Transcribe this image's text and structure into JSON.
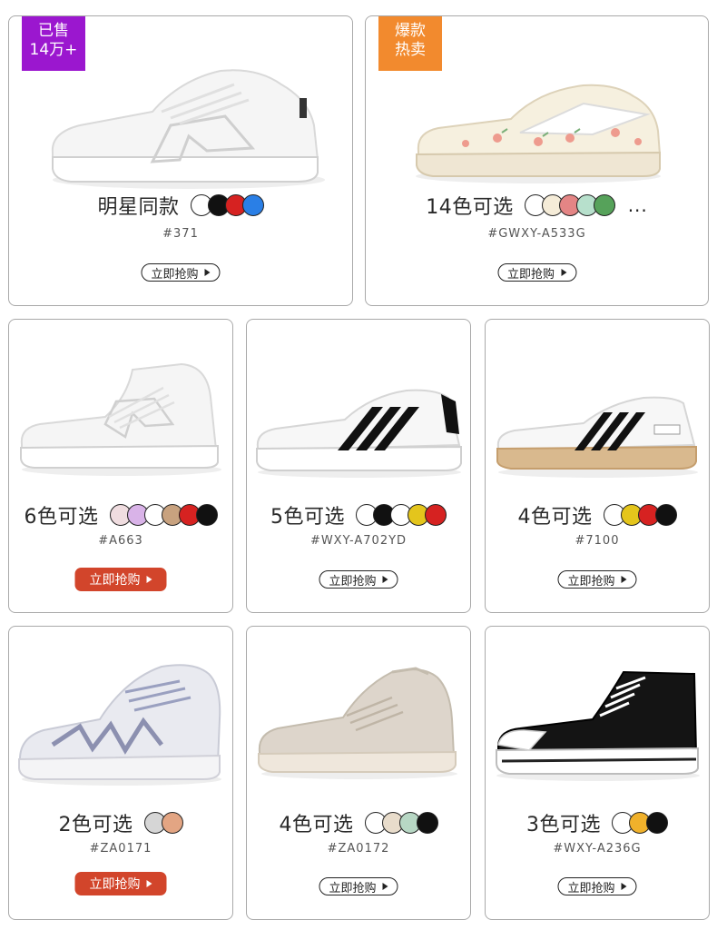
{
  "products": [
    {
      "title": "明星同款",
      "code": "#371",
      "button": "立即抢购",
      "badge": "已售\n14万+",
      "badge_color": "#9b17cf",
      "colors": [
        "#ffffff",
        "#111111",
        "#d62221",
        "#2a7fe6"
      ],
      "more": "",
      "button_style": "outline",
      "shoe": "low-white"
    },
    {
      "title": "14色可选",
      "code": "#GWXY-A533G",
      "button": "立即抢购",
      "badge": "爆款\n热卖",
      "badge_color": "#f28a2e",
      "colors": [
        "#ffffff",
        "#f5ecd8",
        "#e48585",
        "#b7e0cc",
        "#56a25a"
      ],
      "more": "...",
      "button_style": "outline",
      "shoe": "canvas-peach"
    },
    {
      "title": "6色可选",
      "code": "#A663",
      "button": "立即抢购",
      "badge": "",
      "badge_color": "",
      "colors": [
        "#f0dde0",
        "#d9b3e8",
        "#ffffff",
        "#c8a27f",
        "#d62221",
        "#111111"
      ],
      "more": "",
      "button_style": "red",
      "shoe": "high-white"
    },
    {
      "title": "5色可选",
      "code": "#WXY-A702YD",
      "button": "立即抢购",
      "badge": "",
      "badge_color": "",
      "colors": [
        "#ffffff",
        "#111111",
        "#ffffff",
        "#e4c51c",
        "#d62221"
      ],
      "more": "",
      "button_style": "outline",
      "shoe": "stripe-white"
    },
    {
      "title": "4色可选",
      "code": "#7100",
      "button": "立即抢购",
      "badge": "",
      "badge_color": "",
      "colors": [
        "#ffffff",
        "#e4c51c",
        "#d62221",
        "#111111"
      ],
      "more": "",
      "button_style": "outline",
      "shoe": "stripe-gum"
    },
    {
      "title": "2色可选",
      "code": "#ZA0171",
      "button": "立即抢购",
      "badge": "",
      "badge_color": "",
      "colors": [
        "#d6d6d6",
        "#e3a583"
      ],
      "more": "",
      "button_style": "red",
      "shoe": "runner-grey"
    },
    {
      "title": "4色可选",
      "code": "#ZA0172",
      "button": "立即抢购",
      "badge": "",
      "badge_color": "",
      "colors": [
        "#ffffff",
        "#e8dccb",
        "#b7d7c4",
        "#111111"
      ],
      "more": "",
      "button_style": "outline",
      "shoe": "knit-beige"
    },
    {
      "title": "3色可选",
      "code": "#WXY-A236G",
      "button": "立即抢购",
      "badge": "",
      "badge_color": "",
      "colors": [
        "#ffffff",
        "#f0b12b",
        "#111111"
      ],
      "more": "",
      "button_style": "outline",
      "shoe": "canvas-black"
    }
  ]
}
